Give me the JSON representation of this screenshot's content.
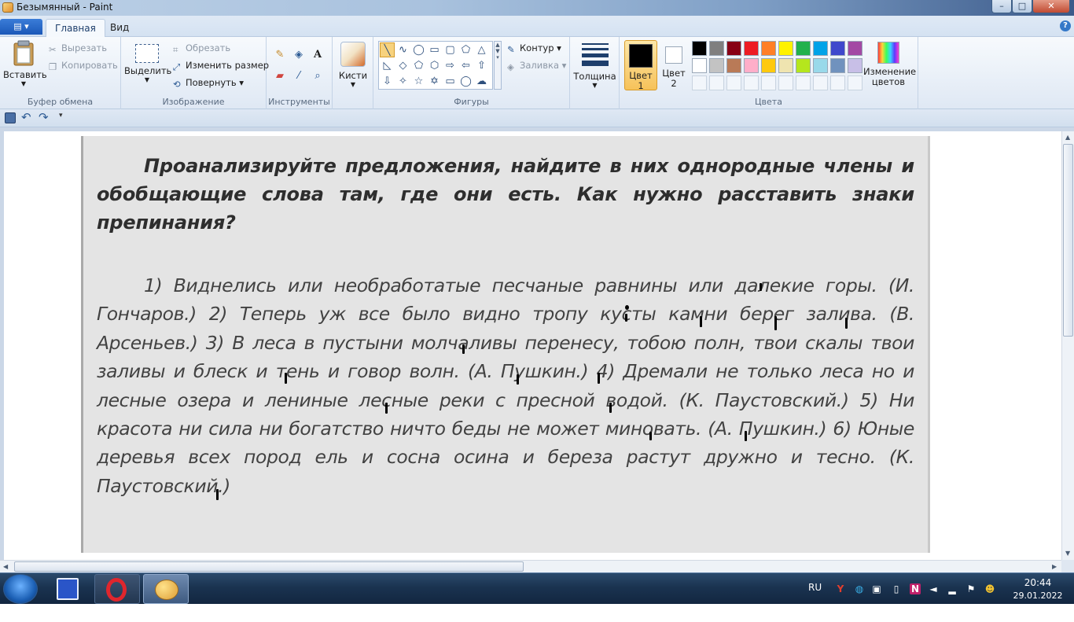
{
  "window": {
    "title": "Безымянный - Paint",
    "min": "–",
    "max": "□",
    "close": "✕"
  },
  "menu": {
    "file_label": "▤ ▾",
    "tabs": [
      "Главная",
      "Вид"
    ],
    "help": "?"
  },
  "ribbon": {
    "clipboard": {
      "label": "Буфер обмена",
      "paste": "Вставить",
      "cut": "Вырезать",
      "copy": "Копировать"
    },
    "image": {
      "label": "Изображение",
      "select": "Выделить",
      "crop": "Обрезать",
      "resize": "Изменить размер",
      "rotate": "Повернуть ▾"
    },
    "tools": {
      "label": "Инструменты"
    },
    "brushes": {
      "label": "Кисти"
    },
    "shapes": {
      "label": "Фигуры",
      "outline": "Контур ▾",
      "fill": "Заливка ▾"
    },
    "size": {
      "label": "Толщина"
    },
    "colors": {
      "label": "Цвета",
      "color1": "Цвет 1",
      "color2": "Цвет 2",
      "edit": "Изменение цветов",
      "palette_row1": [
        "#000000",
        "#7f7f7f",
        "#880015",
        "#ed1c24",
        "#ff7f27",
        "#fff200",
        "#22b14c",
        "#00a2e8",
        "#3f48cc",
        "#a349a4"
      ],
      "palette_row2": [
        "#ffffff",
        "#c3c3c3",
        "#b97a57",
        "#ffaec9",
        "#ffc90e",
        "#efe4b0",
        "#b5e61d",
        "#99d9ea",
        "#7092be",
        "#c8bfe7"
      ],
      "color1_value": "#000000",
      "color2_value": "#ffffff"
    }
  },
  "document": {
    "heading": "Проанализируйте предложения, найдите в них однородные члены и обобщающие слова там, где они есть. Как нужно расставить знаки препинания?",
    "body": "1) Виднелись или необработатые песчаные равнины или далекие горы. (И. Гончаров.) 2) Теперь уж все было видно тропу кусты камни берег залива. (В. Арсеньев.) 3) В леса в пустыни молчаливы перенесу, тобою полн, твои скалы твои заливы и блеск и тень и говор волн. (А. Пушкин.) 4) Дремали не только леса но и лесные озера и лениные лесные реки с пресной водой. (К. Паустовский.) 5) Ни красота ни сила ни богатство ничто беды не может миновать. (А. Пушкин.) 6) Юные деревья всех пород ель и сосна осина и береза растут дружно и тесно. (К. Паустовский.)"
  },
  "taskbar": {
    "lang": "RU",
    "time": "20:44",
    "date": "29.01.2022"
  }
}
